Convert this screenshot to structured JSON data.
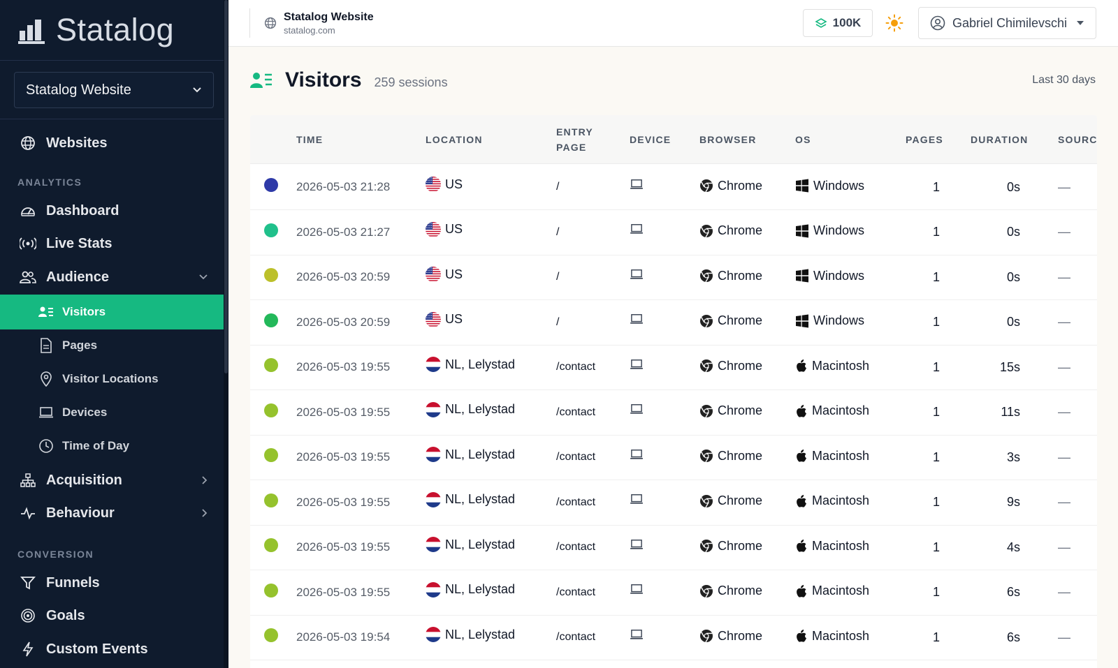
{
  "app": {
    "name": "Statalog"
  },
  "sidebar": {
    "site_select": "Statalog Website",
    "websites": "Websites",
    "analytics_label": "ANALYTICS",
    "dashboard": "Dashboard",
    "live_stats": "Live Stats",
    "audience": "Audience",
    "audience_items": [
      "Visitors",
      "Pages",
      "Visitor Locations",
      "Devices",
      "Time of Day"
    ],
    "acquisition": "Acquisition",
    "behaviour": "Behaviour",
    "conversion_label": "CONVERSION",
    "funnels": "Funnels",
    "goals": "Goals",
    "custom_events": "Custom Events"
  },
  "topbar": {
    "site_name": "Statalog Website",
    "site_url": "statalog.com",
    "quota": "100K",
    "user_name": "Gabriel Chimilevschi"
  },
  "page": {
    "title": "Visitors",
    "sessions": "259 sessions",
    "range": "Last 30 days"
  },
  "table": {
    "headers": [
      "TIME",
      "LOCATION",
      "ENTRY\nPAGE",
      "DEVICE",
      "BROWSER",
      "OS",
      "PAGES",
      "DURATION",
      "SOURC"
    ],
    "rows": [
      {
        "dot": "#2e3aa8",
        "time": "2026-05-03 21:28",
        "flag": "us",
        "location": "US",
        "entry": "/",
        "browser": "Chrome",
        "os": "Windows",
        "os_icon": "windows-icon",
        "pages": "1",
        "duration": "0s",
        "source": "—"
      },
      {
        "dot": "#20c08b",
        "time": "2026-05-03 21:27",
        "flag": "us",
        "location": "US",
        "entry": "/",
        "browser": "Chrome",
        "os": "Windows",
        "os_icon": "windows-icon",
        "pages": "1",
        "duration": "0s",
        "source": "—"
      },
      {
        "dot": "#bcc02a",
        "time": "2026-05-03 20:59",
        "flag": "us",
        "location": "US",
        "entry": "/",
        "browser": "Chrome",
        "os": "Windows",
        "os_icon": "windows-icon",
        "pages": "1",
        "duration": "0s",
        "source": "—"
      },
      {
        "dot": "#23b85a",
        "time": "2026-05-03 20:59",
        "flag": "us",
        "location": "US",
        "entry": "/",
        "browser": "Chrome",
        "os": "Windows",
        "os_icon": "windows-icon",
        "pages": "1",
        "duration": "0s",
        "source": "—"
      },
      {
        "dot": "#95c22d",
        "time": "2026-05-03 19:55",
        "flag": "nl",
        "location": "NL, Lelystad",
        "entry": "/contact",
        "browser": "Chrome",
        "os": "Macintosh",
        "os_icon": "apple-icon",
        "pages": "1",
        "duration": "15s",
        "source": "—"
      },
      {
        "dot": "#95c22d",
        "time": "2026-05-03 19:55",
        "flag": "nl",
        "location": "NL, Lelystad",
        "entry": "/contact",
        "browser": "Chrome",
        "os": "Macintosh",
        "os_icon": "apple-icon",
        "pages": "1",
        "duration": "11s",
        "source": "—"
      },
      {
        "dot": "#95c22d",
        "time": "2026-05-03 19:55",
        "flag": "nl",
        "location": "NL, Lelystad",
        "entry": "/contact",
        "browser": "Chrome",
        "os": "Macintosh",
        "os_icon": "apple-icon",
        "pages": "1",
        "duration": "3s",
        "source": "—"
      },
      {
        "dot": "#95c22d",
        "time": "2026-05-03 19:55",
        "flag": "nl",
        "location": "NL, Lelystad",
        "entry": "/contact",
        "browser": "Chrome",
        "os": "Macintosh",
        "os_icon": "apple-icon",
        "pages": "1",
        "duration": "9s",
        "source": "—"
      },
      {
        "dot": "#95c22d",
        "time": "2026-05-03 19:55",
        "flag": "nl",
        "location": "NL, Lelystad",
        "entry": "/contact",
        "browser": "Chrome",
        "os": "Macintosh",
        "os_icon": "apple-icon",
        "pages": "1",
        "duration": "4s",
        "source": "—"
      },
      {
        "dot": "#95c22d",
        "time": "2026-05-03 19:55",
        "flag": "nl",
        "location": "NL, Lelystad",
        "entry": "/contact",
        "browser": "Chrome",
        "os": "Macintosh",
        "os_icon": "apple-icon",
        "pages": "1",
        "duration": "6s",
        "source": "—"
      },
      {
        "dot": "#95c22d",
        "time": "2026-05-03 19:54",
        "flag": "nl",
        "location": "NL, Lelystad",
        "entry": "/contact",
        "browser": "Chrome",
        "os": "Macintosh",
        "os_icon": "apple-icon",
        "pages": "1",
        "duration": "6s",
        "source": "—"
      }
    ]
  },
  "colors": {
    "accent": "#16b981",
    "sidebar_bg": "#0f1b2d",
    "page_bg": "#fbf9f4"
  }
}
